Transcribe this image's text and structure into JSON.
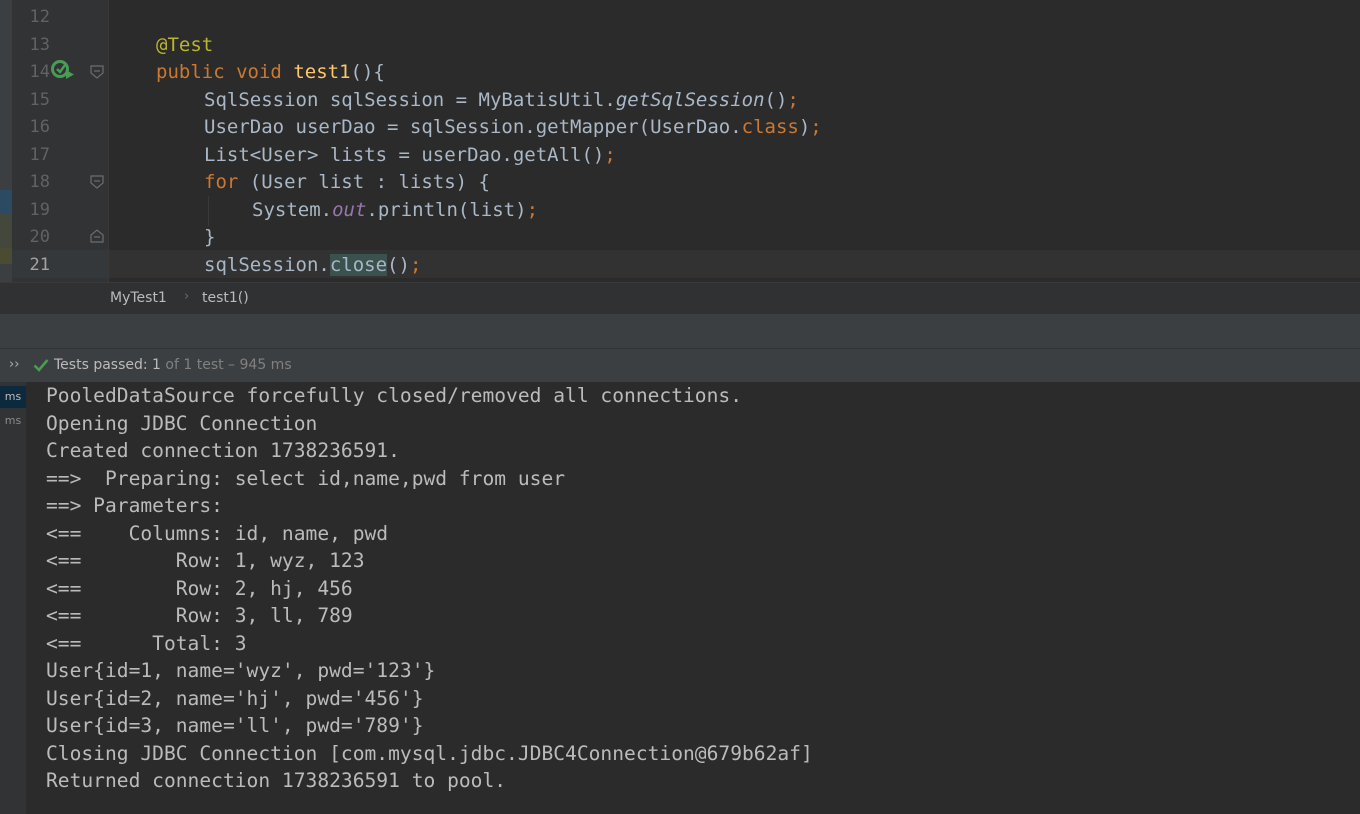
{
  "editor": {
    "gutter": {
      "line_numbers": [
        "12",
        "13",
        "14",
        "15",
        "16",
        "17",
        "18",
        "19",
        "20",
        "21"
      ]
    },
    "code": {
      "l13_annotation": "@Test",
      "l14_public": "public",
      "l14_void": "void",
      "l14_method": "test1",
      "l14_rest": "(){",
      "l15_a": "SqlSession sqlSession = MyBatisUtil.",
      "l15_b": "getSqlSession",
      "l15_c": "()",
      "l15_d": ";",
      "l16_a": "UserDao userDao = sqlSession.getMapper(UserDao.",
      "l16_b": "class",
      "l16_c": ")",
      "l16_d": ";",
      "l17_a": "List<User> lists = userDao.getAll()",
      "l17_b": ";",
      "l18_kw": "for",
      "l18_rest": " (User list : lists) {",
      "l19_a": "System.",
      "l19_b": "out",
      "l19_c": ".println(list)",
      "l19_d": ";",
      "l20": "}",
      "l21_a": "sqlSession.",
      "l21_b": "close",
      "l21_c": "()",
      "l21_d": ";"
    }
  },
  "breadcrumb": {
    "class_name": "MyTest1",
    "separator": "›",
    "method_name": "test1()"
  },
  "run": {
    "expand_glyph": "››",
    "status_prefix": "Tests passed: ",
    "passed_count": "1",
    "status_suffix": " of 1 test – 945 ms",
    "side_tabs": [
      "ms",
      "ms"
    ],
    "console_lines": [
      "PooledDataSource forcefully closed/removed all connections.",
      "Opening JDBC Connection",
      "Created connection 1738236591.",
      "==>  Preparing: select id,name,pwd from user",
      "==> Parameters: ",
      "<==    Columns: id, name, pwd",
      "<==        Row: 1, wyz, 123",
      "<==        Row: 2, hj, 456",
      "<==        Row: 3, ll, 789",
      "<==      Total: 3",
      "User{id=1, name='wyz', pwd='123'}",
      "User{id=2, name='hj', pwd='456'}",
      "User{id=3, name='ll', pwd='789'}",
      "Closing JDBC Connection [com.mysql.jdbc.JDBC4Connection@679b62af]",
      "Returned connection 1738236591 to pool."
    ]
  },
  "colors": {
    "background": "#2b2b2b",
    "keyword": "#cc7832",
    "annotation": "#bbb529",
    "method_decl": "#ffc66d",
    "static_field": "#9876aa",
    "plain_code": "#a9b7c6",
    "pass_green": "#499c54"
  }
}
